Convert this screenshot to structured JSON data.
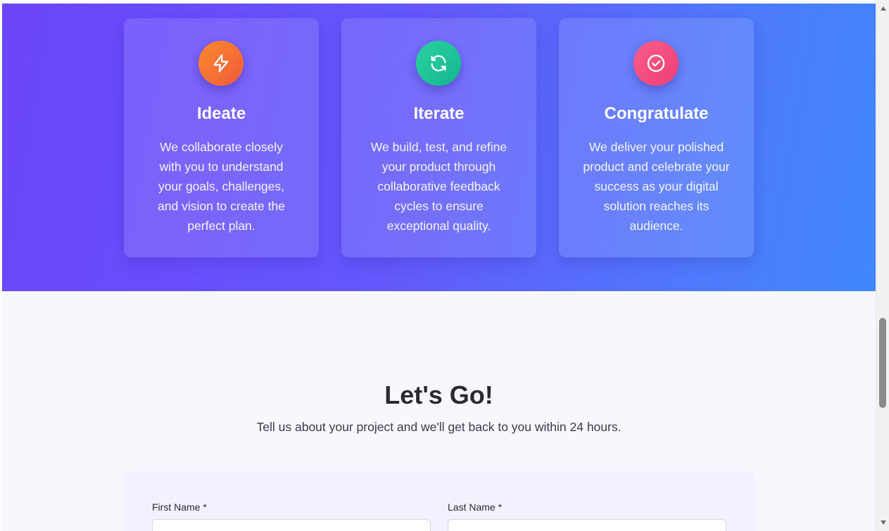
{
  "process": {
    "cards": [
      {
        "icon": "lightning-icon",
        "title": "Ideate",
        "text": "We collaborate closely with you to understand your goals, challenges, and vision to create the perfect plan.",
        "icon_color": "#f26b3a"
      },
      {
        "icon": "refresh-icon",
        "title": "Iterate",
        "text": "We build, test, and refine your product through collaborative feedback cycles to ensure exceptional quality.",
        "icon_color": "#1fc497"
      },
      {
        "icon": "check-circle-icon",
        "title": "Congratulate",
        "text": "We deliver your polished product and celebrate your success as your digital solution reaches its audience.",
        "icon_color": "#f04d7e"
      }
    ],
    "gradient_start": "#6c45fb",
    "gradient_end": "#3f86fc"
  },
  "contact": {
    "title": "Let's Go!",
    "subtitle": "Tell us about your project and we'll get back to you within 24 hours.",
    "first_name_label": "First Name *",
    "first_name_value": "",
    "last_name_label": "Last Name *",
    "last_name_value": ""
  }
}
